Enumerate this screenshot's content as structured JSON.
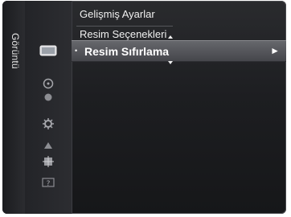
{
  "sidebar": {
    "label": "Görüntü"
  },
  "icons": [
    {
      "name": "picture-icon",
      "glyph": "▦"
    },
    {
      "name": "clock-icon",
      "glyph": "◷"
    },
    {
      "name": "sound-icon",
      "glyph": "◖"
    },
    {
      "name": "setup-icon",
      "glyph": "⚙"
    },
    {
      "name": "input-icon",
      "glyph": "◤"
    },
    {
      "name": "application-icon",
      "glyph": "✱"
    },
    {
      "name": "support-icon",
      "glyph": "?"
    }
  ],
  "menu": {
    "items": [
      {
        "label": "Gelişmiş Ayarlar"
      },
      {
        "label": "Resim Seçenekleri"
      }
    ],
    "selected": {
      "label": "Resim Sıfırlama",
      "bullet": "•",
      "arrow": "►"
    }
  }
}
